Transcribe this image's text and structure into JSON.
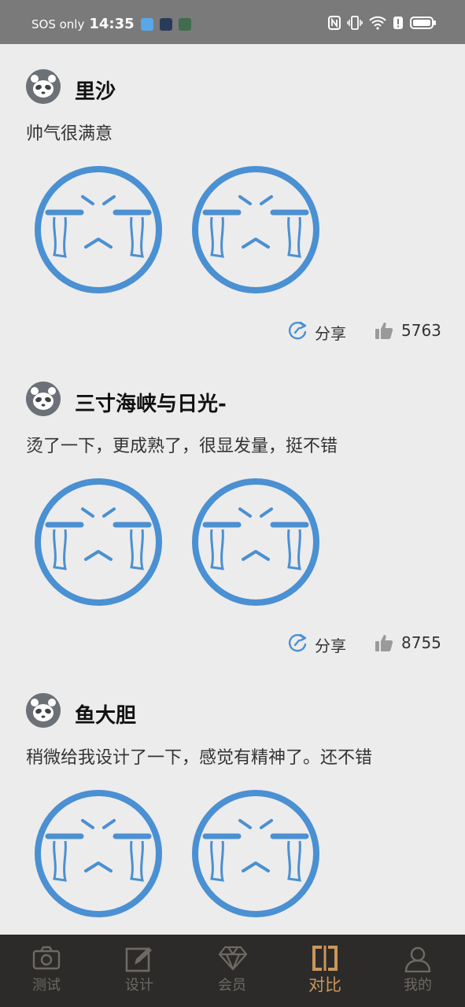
{
  "status_bar": {
    "carrier": "SOS only",
    "time": "14:35"
  },
  "posts": [
    {
      "username": "里沙",
      "comment": "帅气很满意",
      "share_label": "分享",
      "likes": "5763"
    },
    {
      "username": "三寸海峡与日光-",
      "comment": "烫了一下，更成熟了，很显发量，挺不错",
      "share_label": "分享",
      "likes": "8755"
    },
    {
      "username": "鱼大胆",
      "comment": "稍微给我设计了一下，感觉有精神了。还不错"
    }
  ],
  "tabs": [
    {
      "label": "测试",
      "icon": "camera-icon",
      "active": false
    },
    {
      "label": "设计",
      "icon": "edit-icon",
      "active": false
    },
    {
      "label": "会员",
      "icon": "diamond-icon",
      "active": false
    },
    {
      "label": "对比",
      "icon": "compare-icon",
      "active": true
    },
    {
      "label": "我的",
      "icon": "person-icon",
      "active": false
    }
  ],
  "colors": {
    "status_bar": "#7a7a7a",
    "background": "#ececec",
    "emoji_blue": "#4a90d2",
    "tab_bar": "#2c2b2a",
    "tab_active": "#c9975a",
    "tab_inactive": "#6e6a63"
  }
}
